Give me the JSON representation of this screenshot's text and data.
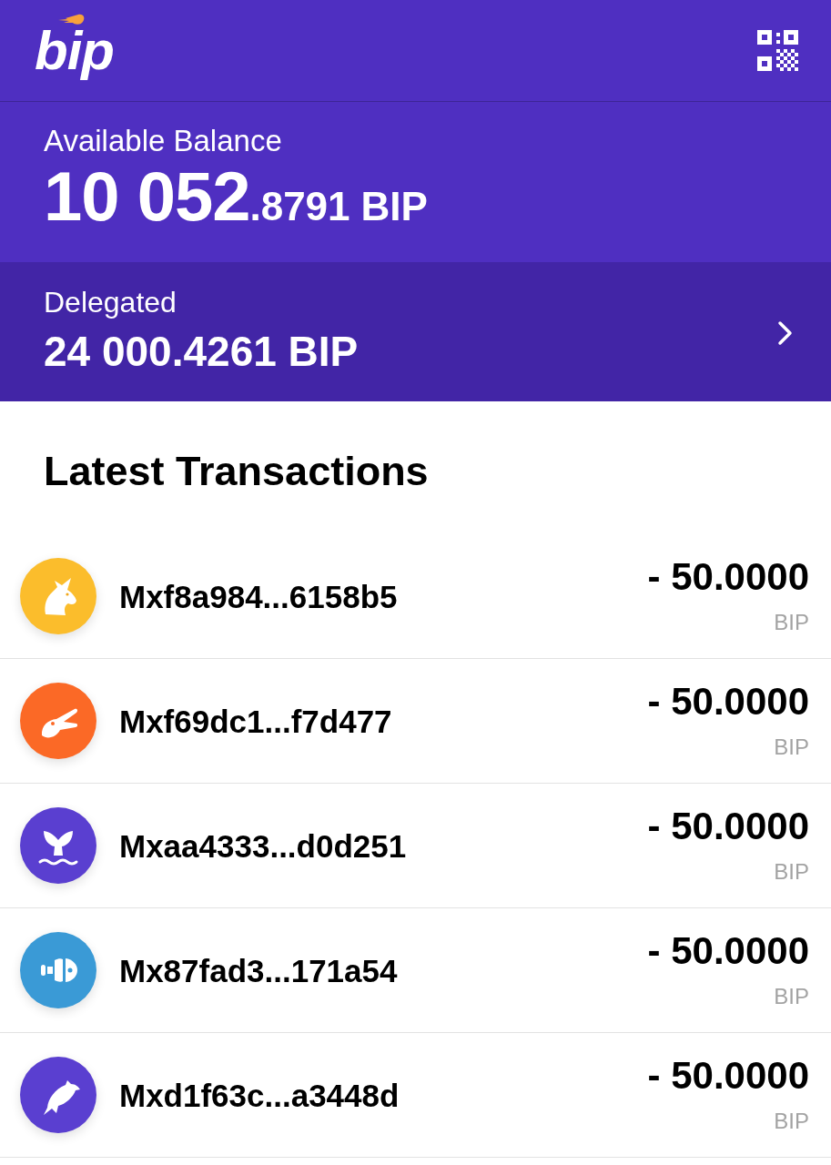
{
  "header": {
    "logo": "bip"
  },
  "balance": {
    "label": "Available Balance",
    "whole": "10 052",
    "fraction": ".8791",
    "currency": "BIP"
  },
  "delegated": {
    "label": "Delegated",
    "amount": "24 000.4261 BIP"
  },
  "transactions": {
    "title": "Latest Transactions",
    "items": [
      {
        "address": "Mxf8a984...6158b5",
        "amount": "- 50.0000",
        "currency": "BIP",
        "color": "#fbbd2c"
      },
      {
        "address": "Mxf69dc1...f7d477",
        "amount": "- 50.0000",
        "currency": "BIP",
        "color": "#fb6926"
      },
      {
        "address": "Mxaa4333...d0d251",
        "amount": "- 50.0000",
        "currency": "BIP",
        "color": "#5a3fd0"
      },
      {
        "address": "Mx87fad3...171a54",
        "amount": "- 50.0000",
        "currency": "BIP",
        "color": "#3a9ad6"
      },
      {
        "address": "Mxd1f63c...a3448d",
        "amount": "- 50.0000",
        "currency": "BIP",
        "color": "#5a3fd0"
      }
    ]
  }
}
